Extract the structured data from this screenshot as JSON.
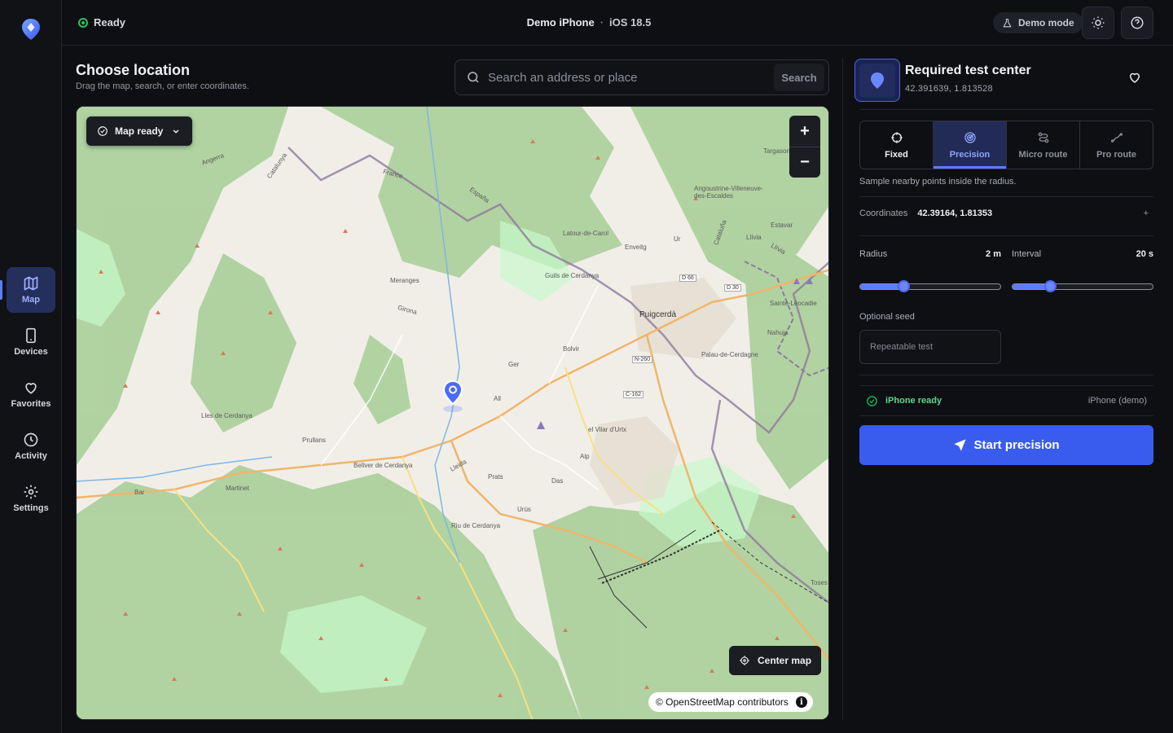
{
  "app": {
    "status": "Ready",
    "device_name": "Demo iPhone",
    "separator": "·",
    "os_version": "iOS 18.5",
    "demo_label": "Demo mode"
  },
  "sidebar": {
    "items": [
      {
        "label": "Map",
        "icon": "map-icon",
        "active": true
      },
      {
        "label": "Devices",
        "icon": "phone-icon",
        "active": false
      },
      {
        "label": "Favorites",
        "icon": "heart-icon",
        "active": false
      },
      {
        "label": "Activity",
        "icon": "clock-icon",
        "active": false
      },
      {
        "label": "Settings",
        "icon": "gear-icon",
        "active": false
      }
    ]
  },
  "main": {
    "title": "Choose location",
    "subtitle": "Drag the map, search, or enter coordinates.",
    "search": {
      "placeholder": "Search an address or place",
      "button": "Search"
    }
  },
  "map": {
    "status_chip": "Map ready",
    "center_button": "Center map",
    "attribution": "© OpenStreetMap contributors",
    "zoom_in": "+",
    "zoom_out": "−",
    "place_labels": [
      "Targasonne",
      "Angoustrine-Villeneuve-des-Escaldes",
      "Estavar",
      "Llívia",
      "Latour-de-Carol",
      "Enveitg",
      "Ur",
      "Guils de Cerdanya",
      "D 66",
      "D 30",
      "Sainte-Léocadie",
      "Puigcerdà",
      "Nahuja",
      "Meranges",
      "Bolvir",
      "N-260",
      "Palau-de-Cerdagne",
      "Ger",
      "C-162",
      "All",
      "Lles de Cerdanya",
      "el Vilar d'Urtx",
      "Prullans",
      "Bellver de Cerdanya",
      "Alp",
      "Prats",
      "Martinet",
      "Das",
      "Bar",
      "Urús",
      "Riu de Cerdanya",
      "Toses",
      "Angerra",
      "Catalunya",
      "France",
      "España",
      "Cataluña",
      "Llívia",
      "Girona",
      "Lleida"
    ]
  },
  "panel": {
    "location_title": "Required test center",
    "location_coords": "42.391639, 1.813528",
    "modes": [
      {
        "label": "Fixed",
        "icon": "crosshair-icon",
        "active": false
      },
      {
        "label": "Precision",
        "icon": "radar-icon",
        "active": true
      },
      {
        "label": "Micro route",
        "icon": "route-icon",
        "active": false
      },
      {
        "label": "Pro route",
        "icon": "pro-route-icon",
        "active": false
      }
    ],
    "mode_description": "Sample nearby points inside the radius.",
    "coordinates_label": "Coordinates",
    "coordinates_value": "42.39164, 1.81353",
    "coordinates_action": "+",
    "radius": {
      "label": "Radius",
      "value_text": "2 m",
      "fraction": 0.31
    },
    "interval": {
      "label": "Interval",
      "value_text": "20 s",
      "fraction": 0.27
    },
    "seed": {
      "label": "Optional seed",
      "placeholder": "Repeatable test"
    },
    "device_ready": "iPhone ready",
    "device_name": "iPhone (demo)",
    "start_button": "Start precision"
  },
  "colors": {
    "accent": "#3a5cee",
    "ready": "#22c55e",
    "background": "#0e0f13"
  }
}
